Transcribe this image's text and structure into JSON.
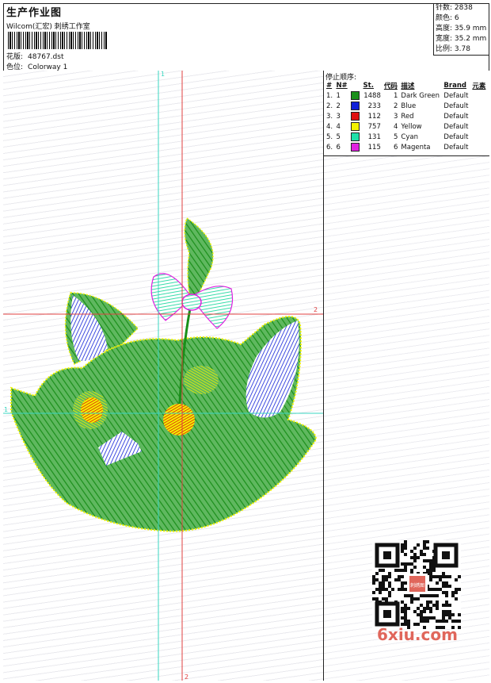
{
  "header": {
    "title": "生产作业图",
    "subtitle": "Wilcom(汇宏) 刺绣工作室",
    "design_label": "花版:",
    "design_file": "48767.dst",
    "colorway_label": "色位:",
    "colorway_name": "Colorway 1"
  },
  "stats": {
    "stitches": "针数: 2838",
    "colors": "颜色: 6",
    "height": "高度: 35.9 mm",
    "width": "宽度: 35.2 mm",
    "scale": "比例: 3.78"
  },
  "stop_sequence": {
    "title": "停止顺序:",
    "headers": [
      "#",
      "N#",
      "St.",
      "代码",
      "描述",
      "Brand",
      "元素"
    ],
    "rows": [
      {
        "idx": "1.",
        "n": "1",
        "color": "#1a8f1a",
        "st": "1488",
        "code": "1",
        "desc": "Dark Green",
        "brand": "Default"
      },
      {
        "idx": "2.",
        "n": "2",
        "color": "#1020d8",
        "st": "233",
        "code": "2",
        "desc": "Blue",
        "brand": "Default"
      },
      {
        "idx": "3.",
        "n": "3",
        "color": "#e01010",
        "st": "112",
        "code": "3",
        "desc": "Red",
        "brand": "Default"
      },
      {
        "idx": "4.",
        "n": "4",
        "color": "#f2f200",
        "st": "757",
        "code": "4",
        "desc": "Yellow",
        "brand": "Default"
      },
      {
        "idx": "5.",
        "n": "5",
        "color": "#20e0a8",
        "st": "131",
        "code": "5",
        "desc": "Cyan",
        "brand": "Default"
      },
      {
        "idx": "6.",
        "n": "6",
        "color": "#e020e0",
        "st": "115",
        "code": "6",
        "desc": "Magenta",
        "brand": "Default"
      }
    ]
  },
  "guides": {
    "cyan_marker": "1",
    "red_marker": "2"
  },
  "watermark": {
    "text": "6xiu.com",
    "stamp": "刺绣图"
  },
  "colors": {
    "dark_green": "#1a8f1a",
    "blue": "#1020d8",
    "red": "#e01010",
    "yellow": "#f2f200",
    "cyan": "#20e0a8",
    "magenta": "#e020e0",
    "guide_cyan": "#3ad6c0",
    "guide_red": "#e04040"
  }
}
